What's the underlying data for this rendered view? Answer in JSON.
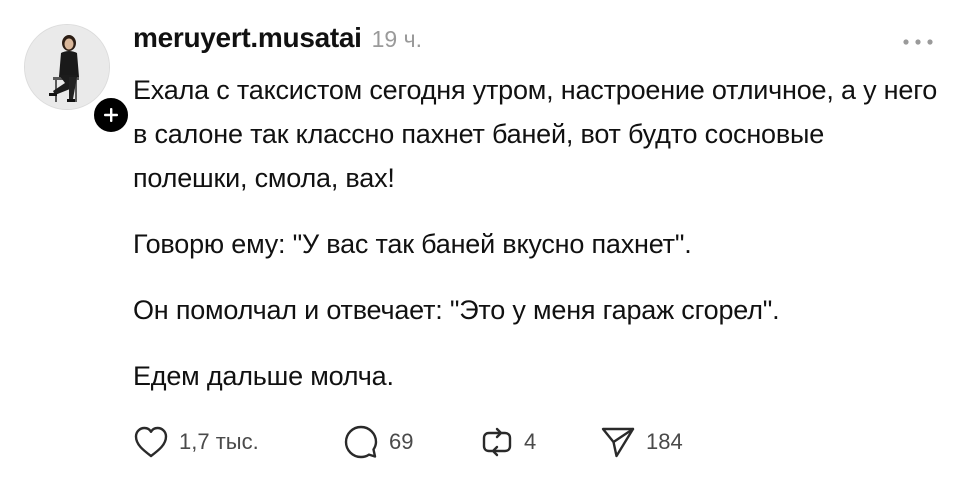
{
  "post": {
    "author": {
      "username": "meruyert.musatai",
      "avatar_icon": "person-portrait",
      "follow_icon": "plus-icon"
    },
    "timestamp": "19 ч.",
    "more_icon": "more-horizontal-icon",
    "paragraphs": [
      "Ехала с таксистом сегодня утром, настроение отличное, а у него в салоне так классно пахнет баней, вот будто сосновые полешки, смола, вах!",
      "Говорю ему: \"У вас так баней вкусно пахнет\".",
      "Он помолчал и отвечает: \"Это у меня гараж сгорел\".",
      "Едем дальше молча."
    ],
    "actions": {
      "like": {
        "icon": "heart-icon",
        "count": "1,7 тыс."
      },
      "reply": {
        "icon": "comment-icon",
        "count": "69"
      },
      "repost": {
        "icon": "repost-icon",
        "count": "4"
      },
      "share": {
        "icon": "send-icon",
        "count": "184"
      }
    }
  },
  "colors": {
    "text": "#111111",
    "muted": "#9a9a9a",
    "icon": "#2a2a2a",
    "badge": "#000000",
    "background": "#ffffff"
  }
}
